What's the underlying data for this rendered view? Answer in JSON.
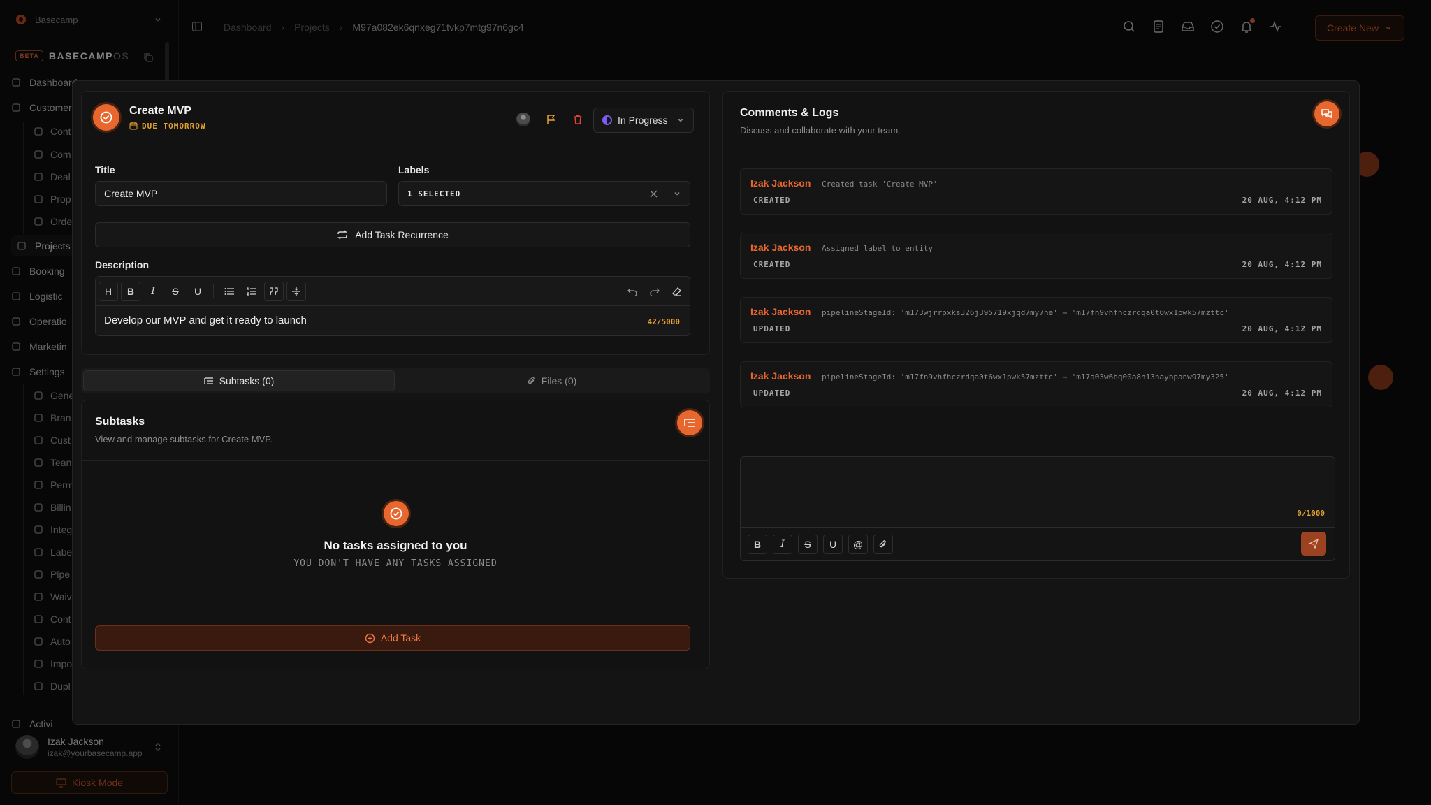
{
  "sidebar": {
    "workspace": "Basecamp",
    "brand_beta": "BETA",
    "brand_main": "BASECAMP",
    "brand_suffix": "OS",
    "items": [
      {
        "label": "Dashboard",
        "icon": "home-icon",
        "sub": false
      },
      {
        "label": "Customers",
        "icon": "users-icon",
        "sub": false
      },
      {
        "label": "Cont",
        "icon": "user-icon",
        "sub": true
      },
      {
        "label": "Com",
        "icon": "building-icon",
        "sub": true
      },
      {
        "label": "Deal",
        "icon": "tag-icon",
        "sub": true
      },
      {
        "label": "Prop",
        "icon": "flask-icon",
        "sub": true
      },
      {
        "label": "Orde",
        "icon": "cart-icon",
        "sub": true
      },
      {
        "label": "Projects",
        "icon": "folder-icon",
        "sub": false,
        "active": true
      },
      {
        "label": "Booking",
        "icon": "ticket-icon",
        "sub": false
      },
      {
        "label": "Logistic",
        "icon": "calendar-icon",
        "sub": false
      },
      {
        "label": "Operatio",
        "icon": "database-icon",
        "sub": false
      },
      {
        "label": "Marketin",
        "icon": "megaphone-icon",
        "sub": false
      },
      {
        "label": "Settings",
        "icon": "settings-icon",
        "sub": false
      },
      {
        "label": "Gene",
        "icon": "sliders-icon",
        "sub": true
      },
      {
        "label": "Bran",
        "icon": "palette-icon",
        "sub": true
      },
      {
        "label": "Cust",
        "icon": "mail-icon",
        "sub": true
      },
      {
        "label": "Tean",
        "icon": "team-icon",
        "sub": true
      },
      {
        "label": "Perm",
        "icon": "lock-icon",
        "sub": true
      },
      {
        "label": "Billin",
        "icon": "card-icon",
        "sub": true
      },
      {
        "label": "Integ",
        "icon": "grid-icon",
        "sub": true
      },
      {
        "label": "Labe",
        "icon": "label-icon",
        "sub": true
      },
      {
        "label": "Pipe",
        "icon": "pipeline-icon",
        "sub": true
      },
      {
        "label": "Waiv",
        "icon": "file-icon",
        "sub": true
      },
      {
        "label": "Cont",
        "icon": "clipboard-icon",
        "sub": true
      },
      {
        "label": "Auto",
        "icon": "automation-icon",
        "sub": true
      },
      {
        "label": "Impo",
        "icon": "import-icon",
        "sub": true
      },
      {
        "label": "Dupl",
        "icon": "duplicate-icon",
        "sub": true
      },
      {
        "label": "Activi",
        "icon": "activity-icon",
        "sub": false
      }
    ],
    "user_name": "Izak Jackson",
    "user_email": "izak@yourbasecamp.app",
    "kiosk_label": "Kiosk Mode"
  },
  "header": {
    "breadcrumbs": [
      "Dashboard",
      "Projects",
      "M97a082ek6qnxeg71tvkp7mtg97n6gc4"
    ],
    "create_new": "Create New",
    "icons": [
      "search-icon",
      "document-icon",
      "inbox-icon",
      "check-circle-icon",
      "bell-icon",
      "activity-icon"
    ]
  },
  "task": {
    "title": "Create MVP",
    "due": "DUE TOMORROW",
    "status": "In Progress",
    "title_label": "Title",
    "title_value": "Create MVP",
    "labels_label": "Labels",
    "labels_value": "1 SELECTED",
    "recurrence_button": "Add Task Recurrence",
    "description_label": "Description",
    "description_value": "Develop our MVP and get it ready to launch",
    "description_count": "42/5000",
    "toolbar": [
      "H",
      "B",
      "I",
      "S",
      "U"
    ]
  },
  "tabs": {
    "subtasks": "Subtasks (0)",
    "files": "Files (0)"
  },
  "subtasks": {
    "title": "Subtasks",
    "subtitle": "View and manage subtasks for Create MVP.",
    "empty_title": "No tasks assigned to you",
    "empty_sub": "YOU DON'T HAVE ANY TASKS ASSIGNED",
    "add_button": "Add Task"
  },
  "comments": {
    "title": "Comments & Logs",
    "subtitle": "Discuss and collaborate with your team.",
    "logs": [
      {
        "user": "Izak Jackson",
        "action": "Created task 'Create MVP'",
        "tag": "CREATED",
        "time": "20 AUG, 4:12 PM"
      },
      {
        "user": "Izak Jackson",
        "action": "Assigned label to entity",
        "tag": "CREATED",
        "time": "20 AUG, 4:12 PM"
      },
      {
        "user": "Izak Jackson",
        "action": "pipelineStageId: 'm173wjrrpxks326j395719xjqd7my7ne' → 'm17fn9vhfhczrdqa0t6wx1pwk57mzttc'",
        "tag": "UPDATED",
        "time": "20 AUG, 4:12 PM"
      },
      {
        "user": "Izak Jackson",
        "action": "pipelineStageId: 'm17fn9vhfhczrdqa0t6wx1pwk57mzttc' → 'm17a03w6bq00a8n13haybpanw97my325'",
        "tag": "UPDATED",
        "time": "20 AUG, 4:12 PM"
      }
    ],
    "input_placeholder": "",
    "input_count": "0/1000"
  },
  "colors": {
    "accent": "#e7672f",
    "due": "#e7a12f",
    "background": "#0b0b0c",
    "status_ring": "#7b5cf0"
  }
}
